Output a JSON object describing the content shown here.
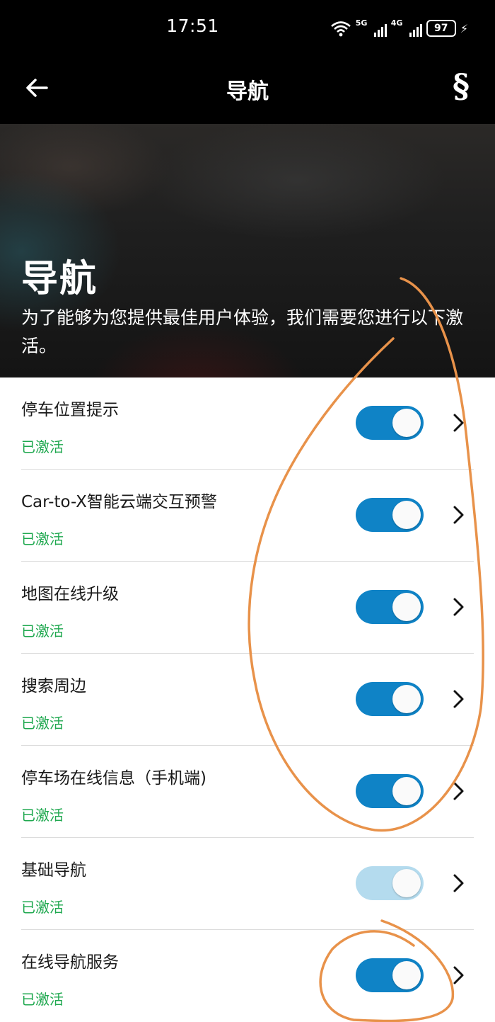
{
  "status_bar": {
    "time": "17:51",
    "network1": "5G",
    "network2": "4G",
    "battery": "97",
    "icons": [
      "wifi-icon",
      "signal-5g-icon",
      "signal-4g-icon",
      "battery-icon",
      "charging-bolt-icon"
    ]
  },
  "app_bar": {
    "title": "导航",
    "legal_symbol": "§",
    "back_icon": "back-arrow-icon"
  },
  "hero": {
    "title": "导航",
    "description": "为了能够为您提供最佳用户体验，我们需要您进行以下激活。"
  },
  "services": [
    {
      "name": "停车位置提示",
      "status": "已激活",
      "enabled": true,
      "locked": false
    },
    {
      "name": "Car-to-X智能云端交互预警",
      "status": "已激活",
      "enabled": true,
      "locked": false
    },
    {
      "name": "地图在线升级",
      "status": "已激活",
      "enabled": true,
      "locked": false
    },
    {
      "name": "搜索周边",
      "status": "已激活",
      "enabled": true,
      "locked": false
    },
    {
      "name": "停车场在线信息（手机端)",
      "status": "已激活",
      "enabled": true,
      "locked": false
    },
    {
      "name": "基础导航",
      "status": "已激活",
      "enabled": true,
      "locked": true
    },
    {
      "name": "在线导航服务",
      "status": "已激活",
      "enabled": true,
      "locked": false
    }
  ],
  "colors": {
    "toggle_on": "#0f83c6",
    "toggle_disabled": "#b4dbee",
    "status_active": "#1fa84f",
    "annotation": "#e8924a"
  }
}
